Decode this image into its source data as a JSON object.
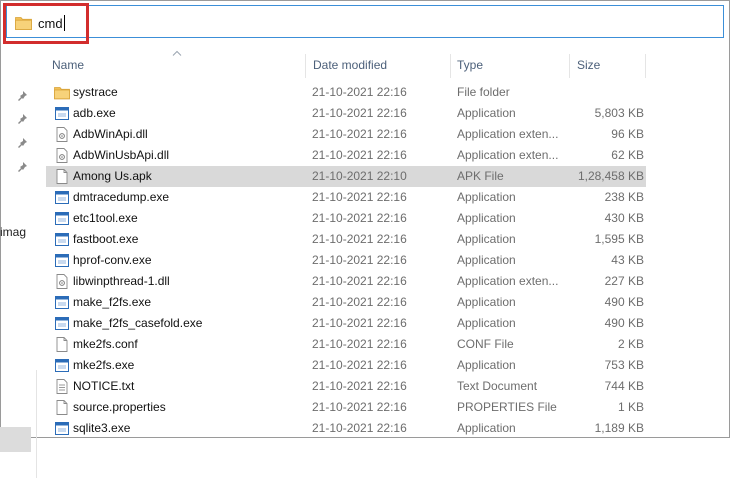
{
  "address": {
    "value": "cmd"
  },
  "sidebar": {
    "partial_text": "imag"
  },
  "columns": {
    "name": "Name",
    "date": "Date modified",
    "type": "Type",
    "size": "Size"
  },
  "files": [
    {
      "name": "systrace",
      "date": "21-10-2021 22:16",
      "type": "File folder",
      "size": "",
      "icon": "folder-icon"
    },
    {
      "name": "adb.exe",
      "date": "21-10-2021 22:16",
      "type": "Application",
      "size": "5,803 KB",
      "icon": "application-icon"
    },
    {
      "name": "AdbWinApi.dll",
      "date": "21-10-2021 22:16",
      "type": "Application exten...",
      "size": "96 KB",
      "icon": "dll-file-icon"
    },
    {
      "name": "AdbWinUsbApi.dll",
      "date": "21-10-2021 22:16",
      "type": "Application exten...",
      "size": "62 KB",
      "icon": "dll-file-icon"
    },
    {
      "name": "Among Us.apk",
      "date": "21-10-2021 22:10",
      "type": "APK File",
      "size": "1,28,458 KB",
      "icon": "file-icon",
      "selected": true
    },
    {
      "name": "dmtracedump.exe",
      "date": "21-10-2021 22:16",
      "type": "Application",
      "size": "238 KB",
      "icon": "application-icon"
    },
    {
      "name": "etc1tool.exe",
      "date": "21-10-2021 22:16",
      "type": "Application",
      "size": "430 KB",
      "icon": "application-icon"
    },
    {
      "name": "fastboot.exe",
      "date": "21-10-2021 22:16",
      "type": "Application",
      "size": "1,595 KB",
      "icon": "application-icon"
    },
    {
      "name": "hprof-conv.exe",
      "date": "21-10-2021 22:16",
      "type": "Application",
      "size": "43 KB",
      "icon": "application-icon"
    },
    {
      "name": "libwinpthread-1.dll",
      "date": "21-10-2021 22:16",
      "type": "Application exten...",
      "size": "227 KB",
      "icon": "dll-file-icon"
    },
    {
      "name": "make_f2fs.exe",
      "date": "21-10-2021 22:16",
      "type": "Application",
      "size": "490 KB",
      "icon": "application-icon"
    },
    {
      "name": "make_f2fs_casefold.exe",
      "date": "21-10-2021 22:16",
      "type": "Application",
      "size": "490 KB",
      "icon": "application-icon"
    },
    {
      "name": "mke2fs.conf",
      "date": "21-10-2021 22:16",
      "type": "CONF File",
      "size": "2 KB",
      "icon": "file-icon"
    },
    {
      "name": "mke2fs.exe",
      "date": "21-10-2021 22:16",
      "type": "Application",
      "size": "753 KB",
      "icon": "application-icon"
    },
    {
      "name": "NOTICE.txt",
      "date": "21-10-2021 22:16",
      "type": "Text Document",
      "size": "744 KB",
      "icon": "text-file-icon"
    },
    {
      "name": "source.properties",
      "date": "21-10-2021 22:16",
      "type": "PROPERTIES File",
      "size": "1 KB",
      "icon": "file-icon"
    },
    {
      "name": "sqlite3.exe",
      "date": "21-10-2021 22:16",
      "type": "Application",
      "size": "1,189 KB",
      "icon": "application-icon"
    }
  ],
  "colors": {
    "highlight": "#d22d2d",
    "address_border": "#3c8fd8",
    "folder": "#f2c057",
    "app_icon": "#2b6cb8",
    "selected_row": "#d9d9d9"
  }
}
